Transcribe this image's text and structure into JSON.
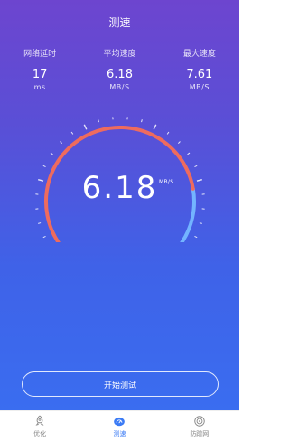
{
  "header": {
    "title": "测速"
  },
  "stats": [
    {
      "label": "网络延时",
      "value": "17",
      "unit": "ms"
    },
    {
      "label": "平均速度",
      "value": "6.18",
      "unit": "MB/S"
    },
    {
      "label": "最大速度",
      "value": "7.61",
      "unit": "MB/S"
    }
  ],
  "gauge": {
    "value": "6.18",
    "unit": "MB/S",
    "level": 0.82,
    "colors": {
      "progress": "#ee6b5e",
      "track": "#73b4ff",
      "ticks": "#ffffff"
    }
  },
  "actions": {
    "start_label": "开始测试"
  },
  "tabs": [
    {
      "label": "优化",
      "icon": "rocket-icon",
      "active": false
    },
    {
      "label": "测速",
      "icon": "speedometer-icon",
      "active": true
    },
    {
      "label": "防蹭网",
      "icon": "shield-target-icon",
      "active": false
    }
  ],
  "colors": {
    "accent": "#3b7bf5",
    "background_top": "#6d45cf",
    "background_bottom": "#3a6df0"
  }
}
